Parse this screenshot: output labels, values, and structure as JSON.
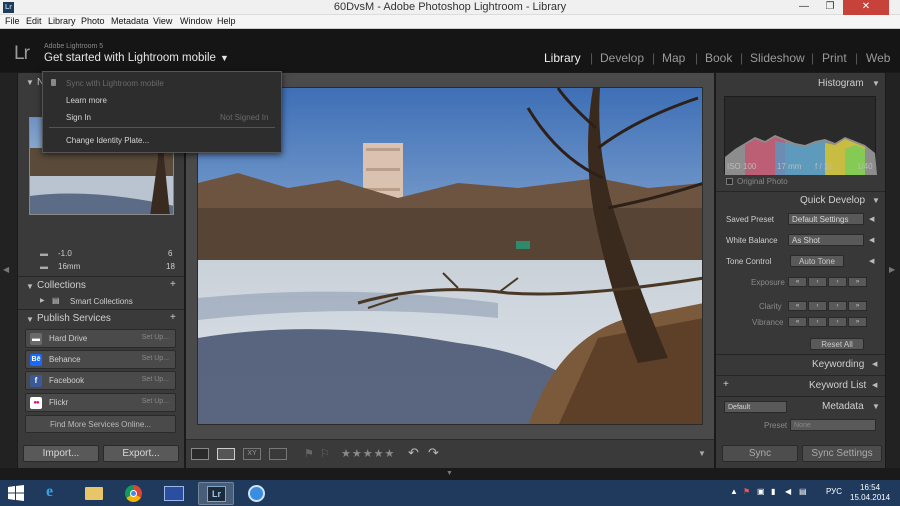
{
  "window": {
    "title": "60DvsM - Adobe Photoshop Lightroom - Library",
    "icon_text": "Lr",
    "minimize_glyph": "—",
    "maximize_glyph": "❐",
    "close_glyph": "✕"
  },
  "menu": [
    "File",
    "Edit",
    "Library",
    "Photo",
    "Metadata",
    "View",
    "Window",
    "Help"
  ],
  "identity": {
    "logo": "Lr",
    "version": "Adobe Lightroom 5",
    "mobile_label": "Get started with Lightroom mobile",
    "caret": "▼"
  },
  "modules": [
    "Library",
    "Develop",
    "Map",
    "Book",
    "Slideshow",
    "Print",
    "Web"
  ],
  "active_module": "Library",
  "popup": {
    "sync": "Sync with Lightroom mobile",
    "learn_more": "Learn more",
    "sign_in": "Sign In",
    "sign_in_status": "Not Signed In",
    "change_identity": "Change Identity Plate..."
  },
  "left_panel": {
    "navigator_partial": "N",
    "folder_partial_label": "-1.0",
    "folder_partial_count": "6",
    "folder_label": "16mm",
    "folder_count": "18",
    "collections": "Collections",
    "smart_collections": "Smart Collections",
    "publish_services": "Publish Services",
    "services": [
      {
        "label": "Hard Drive",
        "setup": "Set Up...",
        "icon": "hard-drive-icon",
        "color": "#6a6a6a",
        "glyph": "▬"
      },
      {
        "label": "Behance",
        "setup": "Set Up...",
        "icon": "behance-icon",
        "color": "#1769ff",
        "glyph": "Bē"
      },
      {
        "label": "Facebook",
        "setup": "Set Up...",
        "icon": "facebook-icon",
        "color": "#3b5998",
        "glyph": "f"
      },
      {
        "label": "Flickr",
        "setup": "Set Up...",
        "icon": "flickr-icon",
        "color": "#ffffff",
        "glyph": "●●"
      }
    ],
    "find_more": "Find More Services Online...",
    "import": "Import...",
    "export": "Export..."
  },
  "right_panel": {
    "histogram": "Histogram",
    "iso": "ISO 100",
    "focal": "17 mm",
    "aperture": "f / 16",
    "shutter": "1/40",
    "original_photo": "Original Photo",
    "quick_develop": "Quick Develop",
    "saved_preset_label": "Saved Preset",
    "saved_preset_value": "Default Settings",
    "white_balance_label": "White Balance",
    "white_balance_value": "As Shot",
    "tone_control_label": "Tone Control",
    "auto_tone": "Auto Tone",
    "exposure": "Exposure",
    "clarity": "Clarity",
    "vibrance": "Vibrance",
    "reset_all": "Reset All",
    "keywording": "Keywording",
    "keyword_list": "Keyword List",
    "metadata": "Metadata",
    "metadata_preset_set": "Default",
    "preset_label": "Preset",
    "preset_value": "None",
    "sync": "Sync",
    "sync_settings": "Sync Settings"
  },
  "toolbar": {
    "stars": "★★★★★",
    "xy": "XY"
  },
  "taskbar": {
    "language": "РУС",
    "time": "16:54",
    "date": "15.04.2014",
    "lr_icon": "Lr"
  }
}
